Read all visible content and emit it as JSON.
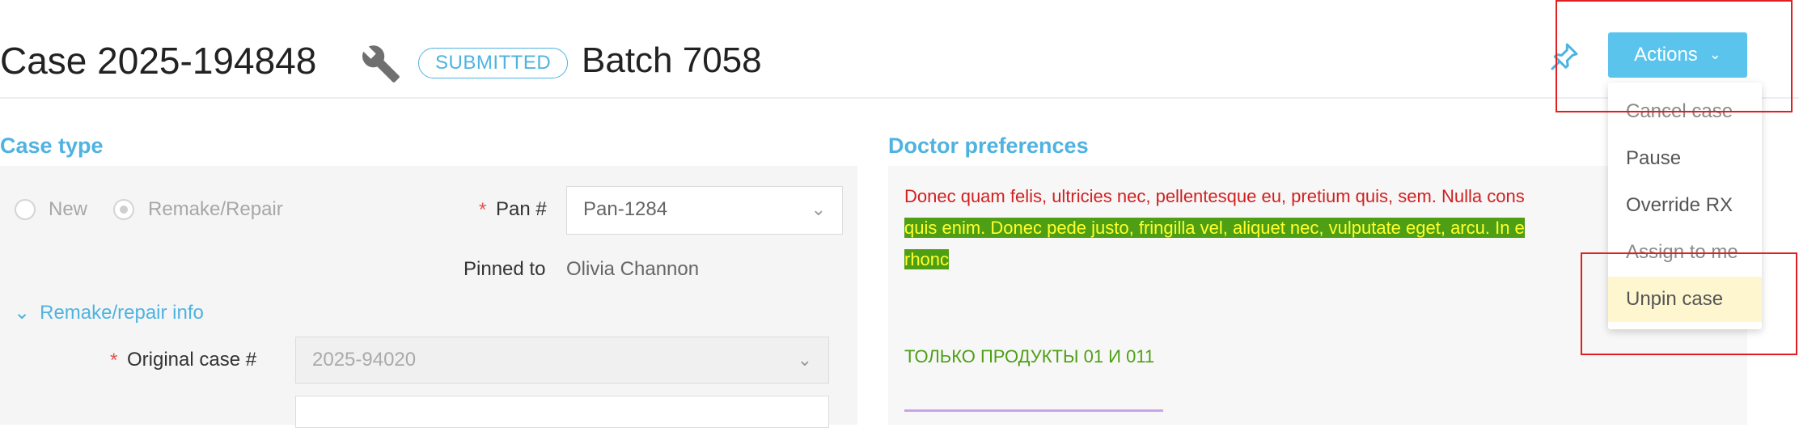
{
  "header": {
    "case_title": "Case 2025-194848",
    "status": "SUBMITTED",
    "batch": "Batch 7058",
    "actions_label": "Actions",
    "accent_color": "#5bc4ec"
  },
  "case_type": {
    "title": "Case type",
    "options": [
      "New",
      "Remake/Repair"
    ],
    "selected": "Remake/Repair",
    "pan_label": "Pan #",
    "pan_value": "Pan-1284",
    "pinned_label": "Pinned to",
    "pinned_value": "Olivia Channon",
    "remake_info_label": "Remake/repair info",
    "original_case_label": "Original case #",
    "original_case_value": "2025-94020"
  },
  "doctor_preferences": {
    "title": "Doctor preferences",
    "line1": "Donec quam felis, ultricies nec, pellentesque eu, pretium quis, sem. Nulla cons",
    "line2": "quis enim. Donec pede justo, fringilla vel, aliquet nec, vulputate eget, arcu. In e",
    "line3": "rhonc",
    "line4": "ТОЛЬКО ПРОДУКТЫ 01 И 011"
  },
  "actions_menu": {
    "items": [
      "Cancel case",
      "Pause",
      "Override RX",
      "Assign to me",
      "Unpin case"
    ],
    "hovered": "Unpin case"
  },
  "icons": {
    "wrench": "wrench-icon",
    "pin": "pin-icon",
    "chevron": "chevron-down-icon"
  }
}
